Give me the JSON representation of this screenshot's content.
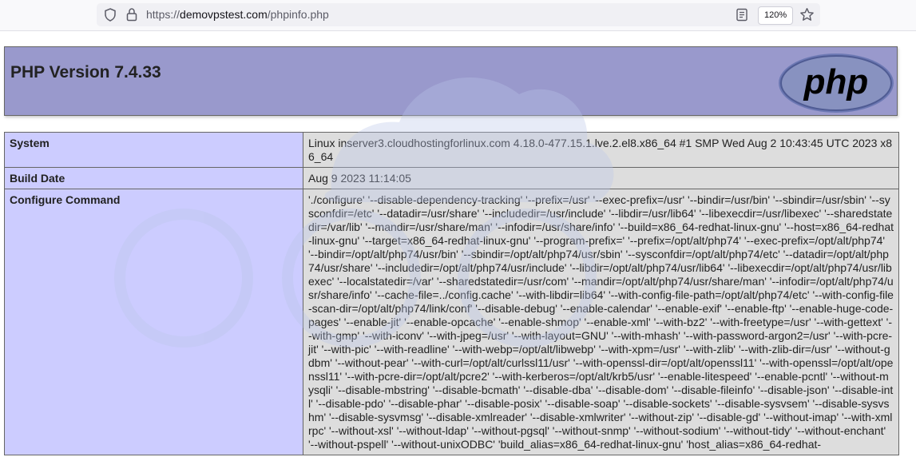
{
  "browser": {
    "url_scheme": "https://",
    "url_host": "demovpstest.com",
    "url_path": "/phpinfo.php",
    "zoom": "120%",
    "icons": [
      "shield-icon",
      "lock-icon",
      "reader-view-icon",
      "bookmark-star-icon"
    ]
  },
  "page": {
    "title": "PHP Version 7.4.33",
    "logo_text": "php",
    "header_bg": "#9999cc",
    "key_bg": "#ccccff",
    "value_bg": "#dddddd"
  },
  "rows": [
    {
      "label": "System",
      "value": "Linux inserver3.cloudhostingforlinux.com 4.18.0-477.15.1.lve.2.el8.x86_64 #1 SMP Wed Aug 2 10:43:45 UTC 2023 x86_64"
    },
    {
      "label": "Build Date",
      "value": "Aug 9 2023 11:14:05"
    },
    {
      "label": "Configure Command",
      "value": "'./configure' '--disable-dependency-tracking' '--prefix=/usr' '--exec-prefix=/usr' '--bindir=/usr/bin' '--sbindir=/usr/sbin' '--sysconfdir=/etc' '--datadir=/usr/share' '--includedir=/usr/include' '--libdir=/usr/lib64' '--libexecdir=/usr/libexec' '--sharedstatedir=/var/lib' '--mandir=/usr/share/man' '--infodir=/usr/share/info' '--build=x86_64-redhat-linux-gnu' '--host=x86_64-redhat-linux-gnu' '--target=x86_64-redhat-linux-gnu' '--program-prefix=' '--prefix=/opt/alt/php74' '--exec-prefix=/opt/alt/php74' '--bindir=/opt/alt/php74/usr/bin' '--sbindir=/opt/alt/php74/usr/sbin' '--sysconfdir=/opt/alt/php74/etc' '--datadir=/opt/alt/php74/usr/share' '--includedir=/opt/alt/php74/usr/include' '--libdir=/opt/alt/php74/usr/lib64' '--libexecdir=/opt/alt/php74/usr/libexec' '--localstatedir=/var' '--sharedstatedir=/usr/com' '--mandir=/opt/alt/php74/usr/share/man' '--infodir=/opt/alt/php74/usr/share/info' '--cache-file=../config.cache' '--with-libdir=lib64' '--with-config-file-path=/opt/alt/php74/etc' '--with-config-file-scan-dir=/opt/alt/php74/link/conf' '--disable-debug' '--enable-calendar' '--enable-exif' '--enable-ftp' '--enable-huge-code-pages' '--enable-jit' '--enable-opcache' '--enable-shmop' '--enable-xml' '--with-bz2' '--with-freetype=/usr' '--with-gettext' '--with-gmp' '--with-iconv' '--with-jpeg=/usr' '--with-layout=GNU' '--with-mhash' '--with-password-argon2=/usr' '--with-pcre-jit' '--with-pic' '--with-readline' '--with-webp=/opt/alt/libwebp' '--with-xpm=/usr' '--with-zlib' '--with-zlib-dir=/usr' '--without-gdbm' '--without-pear' '--with-curl=/opt/alt/curlssl11/usr' '--with-openssl-dir=/opt/alt/openssl11' '--with-openssl=/opt/alt/openssl11' '--with-pcre-dir=/opt/alt/pcre2' '--with-kerberos=/opt/alt/krb5/usr' '--enable-litespeed' '--enable-pcntl' '--without-mysqli' '--disable-mbstring' '--disable-bcmath' '--disable-dba' '--disable-dom' '--disable-fileinfo' '--disable-json' '--disable-intl' '--disable-pdo' '--disable-phar' '--disable-posix' '--disable-soap' '--disable-sockets' '--disable-sysvsem' '--disable-sysvshm' '--disable-sysvmsg' '--disable-xmlreader' '--disable-xmlwriter' '--without-zip' '--disable-gd' '--without-imap' '--with-xmlrpc' '--without-xsl' '--without-ldap' '--without-pgsql' '--without-snmp' '--without-sodium' '--without-tidy' '--without-enchant' '--without-pspell' '--without-unixODBC' 'build_alias=x86_64-redhat-linux-gnu' 'host_alias=x86_64-redhat-"
    }
  ]
}
